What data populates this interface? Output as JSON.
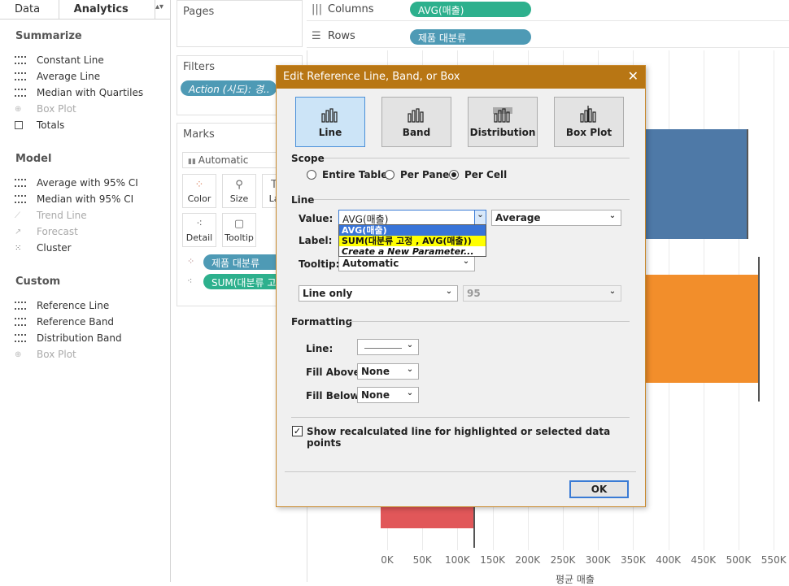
{
  "left_pane": {
    "tabs": [
      "Data",
      "Analytics"
    ],
    "sections": [
      {
        "title": "Summarize",
        "items": [
          {
            "label": "Constant Line",
            "icon": "constant-line-icon",
            "enabled": true
          },
          {
            "label": "Average Line",
            "icon": "average-line-icon",
            "enabled": true
          },
          {
            "label": "Median with Quartiles",
            "icon": "median-quartiles-icon",
            "enabled": true
          },
          {
            "label": "Box Plot",
            "icon": "box-plot-icon",
            "enabled": false
          },
          {
            "label": "Totals",
            "icon": "totals-icon",
            "enabled": true
          }
        ]
      },
      {
        "title": "Model",
        "items": [
          {
            "label": "Average with 95% CI",
            "icon": "average-ci-icon",
            "enabled": true
          },
          {
            "label": "Median with 95% CI",
            "icon": "median-ci-icon",
            "enabled": true
          },
          {
            "label": "Trend Line",
            "icon": "trend-line-icon",
            "enabled": false
          },
          {
            "label": "Forecast",
            "icon": "forecast-icon",
            "enabled": false
          },
          {
            "label": "Cluster",
            "icon": "cluster-icon",
            "enabled": true
          }
        ]
      },
      {
        "title": "Custom",
        "items": [
          {
            "label": "Reference Line",
            "icon": "reference-line-icon",
            "enabled": true
          },
          {
            "label": "Reference Band",
            "icon": "reference-band-icon",
            "enabled": true
          },
          {
            "label": "Distribution Band",
            "icon": "distribution-band-icon",
            "enabled": true
          },
          {
            "label": "Box Plot",
            "icon": "box-plot-icon",
            "enabled": false
          }
        ]
      }
    ]
  },
  "cards": {
    "pages": "Pages",
    "filters": "Filters",
    "filter_pill": "Action (시도): 경..",
    "marks": "Marks",
    "mark_type": "Automatic",
    "mark_buttons": [
      "Color",
      "Size",
      "La",
      "Detail",
      "Tooltip"
    ],
    "mark_pills": [
      "제품 대분류",
      "SUM(대분류 고"
    ]
  },
  "shelves": {
    "columns_label": "Columns",
    "columns_pill": "AVG(매출)",
    "rows_label": "Rows",
    "rows_pill": "제품 대분류"
  },
  "chart_data": {
    "type": "bar",
    "xlabel": "평균 매출",
    "x_ticks": [
      "0K",
      "50K",
      "100K",
      "150K",
      "200K",
      "250K",
      "300K",
      "350K",
      "400K",
      "450K",
      "500K",
      "550K"
    ],
    "colors": {
      "series1": "#4e79a7",
      "series2": "#f28e2b",
      "series3": "#e15759"
    }
  },
  "dialog": {
    "title": "Edit Reference Line, Band, or Box",
    "type_buttons": [
      "Line",
      "Band",
      "Distribution",
      "Box Plot"
    ],
    "scope_title": "Scope",
    "scope_options": [
      "Entire Table",
      "Per Pane",
      "Per Cell"
    ],
    "scope_selected": "Per Cell",
    "line_title": "Line",
    "value_label": "Value:",
    "value_selected": "AVG(매출)",
    "aggregation": "Average",
    "label_label": "Label:",
    "tooltip_label": "Tooltip:",
    "tooltip_value": "Automatic",
    "line_only": "Line only",
    "ci_value": "95",
    "dropdown_options": [
      "AVG(매출)",
      "SUM(대분류 고정 , AVG(매출))",
      "Create a New Parameter..."
    ],
    "formatting_title": "Formatting",
    "line_fmt_label": "Line:",
    "fill_above_label": "Fill Above:",
    "fill_above_value": "None",
    "fill_below_label": "Fill Below:",
    "fill_below_value": "None",
    "recalc_label": "Show recalculated line for highlighted or selected data points",
    "recalc_checked": true,
    "ok_label": "OK"
  }
}
